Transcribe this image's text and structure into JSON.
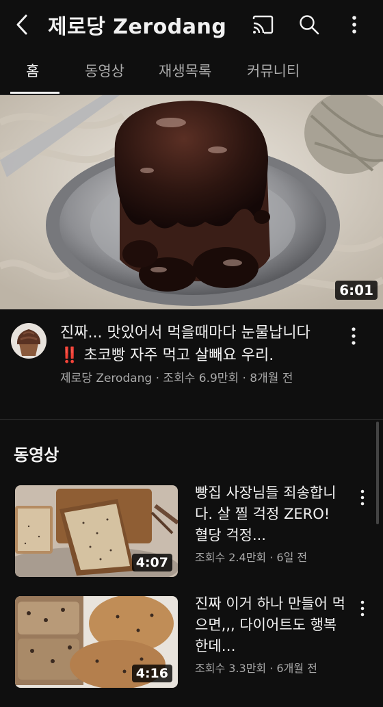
{
  "header": {
    "title": "제로당 Zerodang"
  },
  "tabs": [
    {
      "label": "홈"
    },
    {
      "label": "동영상"
    },
    {
      "label": "재생목록"
    },
    {
      "label": "커뮤니티"
    }
  ],
  "featured": {
    "duration": "6:01",
    "title": "진짜... 맛있어서 먹을때마다 눈물납니다 ‼️ 초코빵 자주 먹고 살빼요 우리.",
    "meta": "제로당 Zerodang · 조회수 6.9만회 · 8개월 전"
  },
  "section": {
    "title": "동영상"
  },
  "videos": [
    {
      "title": "빵집 사장님들 죄송합니다. 살 찔 걱정 ZERO! 혈당 걱정...",
      "meta": "조회수 2.4만회 · 6일 전",
      "duration": "4:07"
    },
    {
      "title": "진짜 이거 하나 만들어 먹으면,,, 다이어트도 행복한데…",
      "meta": "조회수 3.3만회 · 6개월 전",
      "duration": "4:16"
    }
  ],
  "icons": {
    "back": "chevron-left-icon",
    "cast": "cast-icon",
    "search": "search-icon",
    "more": "more-vertical-icon"
  },
  "colors": {
    "background": "#0f0f0f",
    "text": "#f1f1f1",
    "secondary_text": "#aaaaaa"
  }
}
